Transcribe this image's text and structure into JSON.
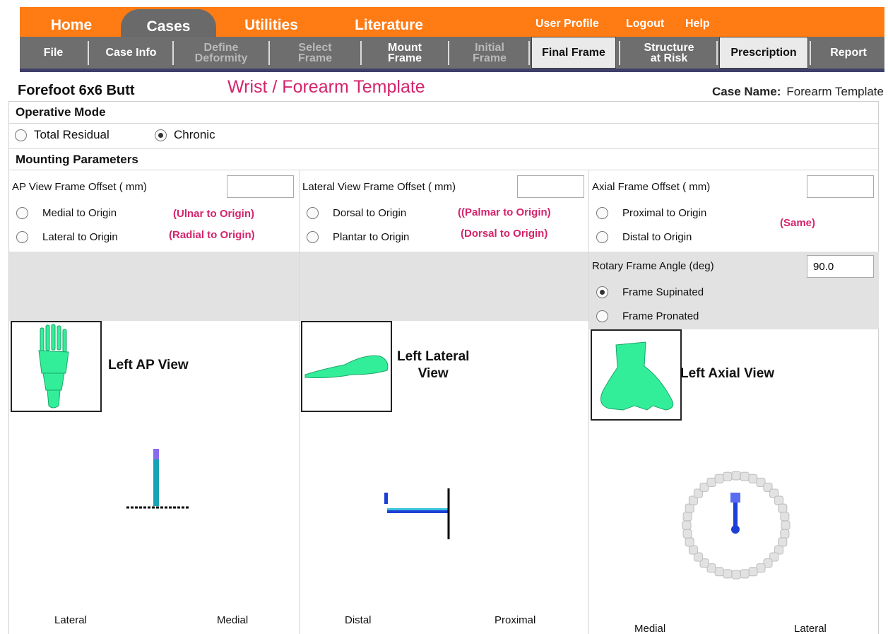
{
  "top_nav": {
    "tabs": [
      "Home",
      "Cases",
      "Utilities",
      "Literature"
    ],
    "active_tab": "Cases",
    "utility_links": [
      "User Profile",
      "Logout",
      "Help"
    ]
  },
  "sub_nav": {
    "items": [
      "File",
      "Case Info",
      "Define\nDeformity",
      "Select\nFrame",
      "Mount\nFrame",
      "Initial\nFrame",
      "Final Frame",
      "Structure\nat Risk",
      "Prescription",
      "Report"
    ],
    "active": "Mount Frame",
    "disabled": [
      "Define Deformity",
      "Select Frame",
      "Initial Frame"
    ]
  },
  "header": {
    "case_title": "Forefoot 6x6 Butt",
    "template_title": "Wrist / Forearm Template",
    "case_name_label": "Case Name:",
    "case_name_value": "Forearm Template"
  },
  "operative_mode": {
    "label": "Operative Mode",
    "options": [
      "Total Residual",
      "Chronic"
    ],
    "selected": "Chronic"
  },
  "mounting": {
    "label": "Mounting Parameters",
    "ap": {
      "offset_label": "AP View Frame Offset ( mm)",
      "offset_value": "",
      "option1": "Medial to Origin",
      "option2": "Lateral to Origin",
      "note1": "(Ulnar to Origin)",
      "note2": "(Radial to Origin)",
      "view_title": "Left AP View",
      "axis_left": "Lateral",
      "axis_right": "Medial"
    },
    "lateral": {
      "offset_label": "Lateral View Frame Offset ( mm)",
      "offset_value": "",
      "option1": "Dorsal to Origin",
      "option2": "Plantar to Origin",
      "note1": "((Palmar to Origin)",
      "note2": "(Dorsal to Origin)",
      "view_title_line1": "Left Lateral",
      "view_title_line2": "View",
      "axis_left": "Distal",
      "axis_right": "Proximal"
    },
    "axial": {
      "offset_label": "Axial Frame Offset ( mm)",
      "offset_value": "",
      "option1": "Proximal to Origin",
      "option2": "Distal to Origin",
      "note": "(Same)",
      "rotary_label": "Rotary Frame Angle (deg)",
      "rotary_value": "90.0",
      "rot_option1": "Frame Supinated",
      "rot_option2": "Frame Pronated",
      "rot_selected": "Frame Supinated",
      "view_title": "Left Axial View",
      "axis_left": "Medial",
      "axis_right": "Lateral"
    }
  },
  "colors": {
    "nav_orange": "#ff7b14",
    "nav_grey": "#6e6e6e",
    "accent_pink": "#d4246b",
    "bone_green": "#33ee99",
    "frame_blue": "#1d3fd6",
    "frame_cyan": "#17a3b5"
  }
}
